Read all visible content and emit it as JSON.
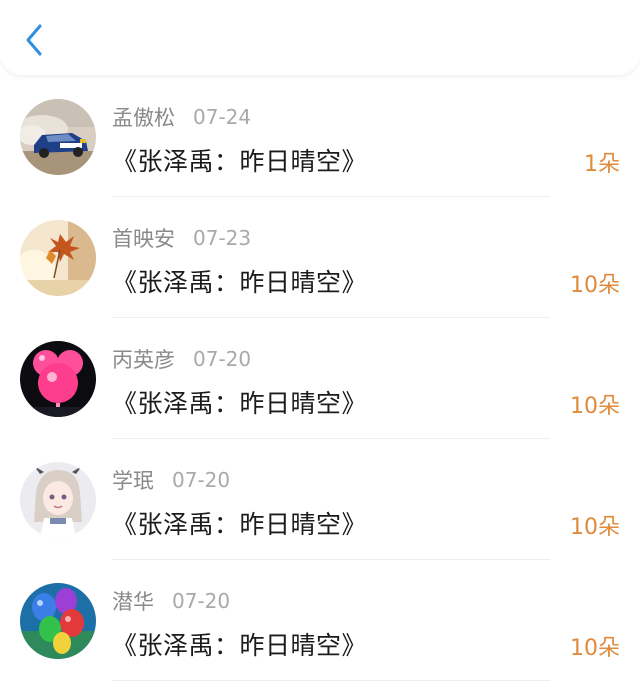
{
  "header": {
    "back_icon": "chevron-left-icon",
    "accent_color": "#2f8fe3"
  },
  "gifts": [
    {
      "name": "孟傲松",
      "date": "07-24",
      "title": "《张泽禹：昨日晴空》",
      "count": "1朵",
      "avatar": "rally-car-photo"
    },
    {
      "name": "首映安",
      "date": "07-23",
      "title": "《张泽禹：昨日晴空》",
      "count": "10朵",
      "avatar": "autumn-leaves-photo"
    },
    {
      "name": "丙英彦",
      "date": "07-20",
      "title": "《张泽禹：昨日晴空》",
      "count": "10朵",
      "avatar": "pink-balloon-photo"
    },
    {
      "name": "学珉",
      "date": "07-20",
      "title": "《张泽禹：昨日晴空》",
      "count": "10朵",
      "avatar": "anime-girl-illustration"
    },
    {
      "name": "潜华",
      "date": "07-20",
      "title": "《张泽禹：昨日晴空》",
      "count": "10朵",
      "avatar": "colorful-balloons-photo"
    }
  ],
  "colors": {
    "count": "#e08a3c",
    "name": "#8a8a8a",
    "title": "#1c1c1c"
  }
}
